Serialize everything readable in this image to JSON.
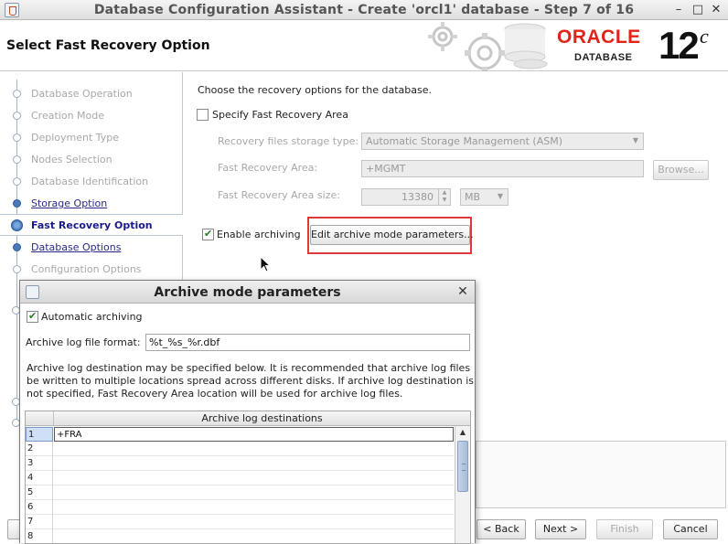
{
  "window": {
    "title": "Database Configuration Assistant - Create 'orcl1' database - Step 7 of 16",
    "minimize_icon": "minimize-icon",
    "maximize_icon": "maximize-icon",
    "close_icon": "close-icon"
  },
  "header": {
    "page_title": "Select Fast Recovery Option",
    "brand_oracle": "ORACLE",
    "brand_database": "DATABASE",
    "brand_version": "12",
    "brand_version_sup": "c",
    "brand_color": "#e2231a"
  },
  "nav": {
    "steps": [
      {
        "label": "Database Operation",
        "state": "done"
      },
      {
        "label": "Creation Mode",
        "state": "done"
      },
      {
        "label": "Deployment Type",
        "state": "done"
      },
      {
        "label": "Nodes Selection",
        "state": "done"
      },
      {
        "label": "Database Identification",
        "state": "done"
      },
      {
        "label": "Storage Option",
        "state": "link"
      },
      {
        "label": "Fast Recovery Option",
        "state": "active"
      },
      {
        "label": "Database Options",
        "state": "link"
      },
      {
        "label": "Configuration Options",
        "state": "pending"
      }
    ]
  },
  "main": {
    "intro": "Choose the recovery options for the database.",
    "specify_fra": {
      "label": "Specify Fast Recovery Area",
      "checked": false
    },
    "storage_type": {
      "label": "Recovery files storage type:",
      "value": "Automatic Storage Management (ASM)"
    },
    "fra_location": {
      "label": "Fast Recovery Area:",
      "value": "+MGMT",
      "browse": "Browse..."
    },
    "fra_size": {
      "label": "Fast Recovery Area size:",
      "value": "13380",
      "unit": "MB"
    },
    "enable_archiving": {
      "label": "Enable archiving",
      "checked": true
    },
    "edit_archive_button": "Edit archive mode parameters...",
    "highlight_color": "#e0393b"
  },
  "footer": {
    "back": "< Back",
    "next": "Next >",
    "finish": "Finish",
    "cancel": "Cancel"
  },
  "dialog": {
    "title": "Archive mode parameters",
    "auto_archiving": {
      "label": "Automatic archiving",
      "checked": true
    },
    "log_format": {
      "label": "Archive log file format:",
      "value": "%t_%s_%r.dbf"
    },
    "description": [
      "Archive log destination may be specified below. It is recommended that archive log files",
      "be written to multiple locations spread across different disks. If archive log destination is",
      "not specified, Fast Recovery Area location will be used for archive log files."
    ],
    "table": {
      "header": "Archive log destinations",
      "rows": [
        {
          "num": "1",
          "value": "+FRA"
        },
        {
          "num": "2",
          "value": ""
        },
        {
          "num": "3",
          "value": ""
        },
        {
          "num": "4",
          "value": ""
        },
        {
          "num": "5",
          "value": ""
        },
        {
          "num": "6",
          "value": ""
        },
        {
          "num": "7",
          "value": ""
        },
        {
          "num": "8",
          "value": ""
        }
      ]
    }
  }
}
